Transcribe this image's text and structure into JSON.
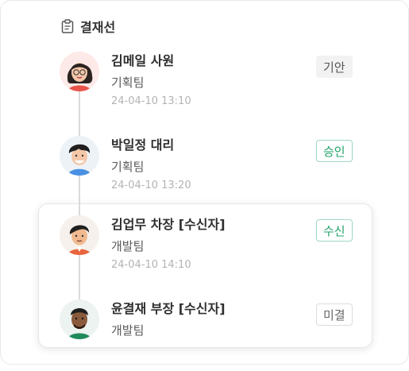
{
  "header": {
    "title": "결재선",
    "icon": "clipboard-icon"
  },
  "approvers": [
    {
      "name": "김메일 사원",
      "dept": "기획팀",
      "time": "24-04-10 13:10",
      "status": "기안",
      "status_style": "pending"
    },
    {
      "name": "박일정 대리",
      "dept": "기획팀",
      "time": "24-04-10 13:20",
      "status": "승인",
      "status_style": "approved"
    },
    {
      "name": "김업무 차장 [수신자]",
      "dept": "개발팀",
      "time": "24-04-10 14:10",
      "status": "수신",
      "status_style": "approved"
    },
    {
      "name": "윤결재 부장 [수신자]",
      "dept": "개발팀",
      "time": "",
      "status": "미결",
      "status_style": "unsigned"
    }
  ],
  "colors": {
    "approved": "#22a36b",
    "timeline": "#dadada",
    "muted": "#b3b3b3"
  }
}
